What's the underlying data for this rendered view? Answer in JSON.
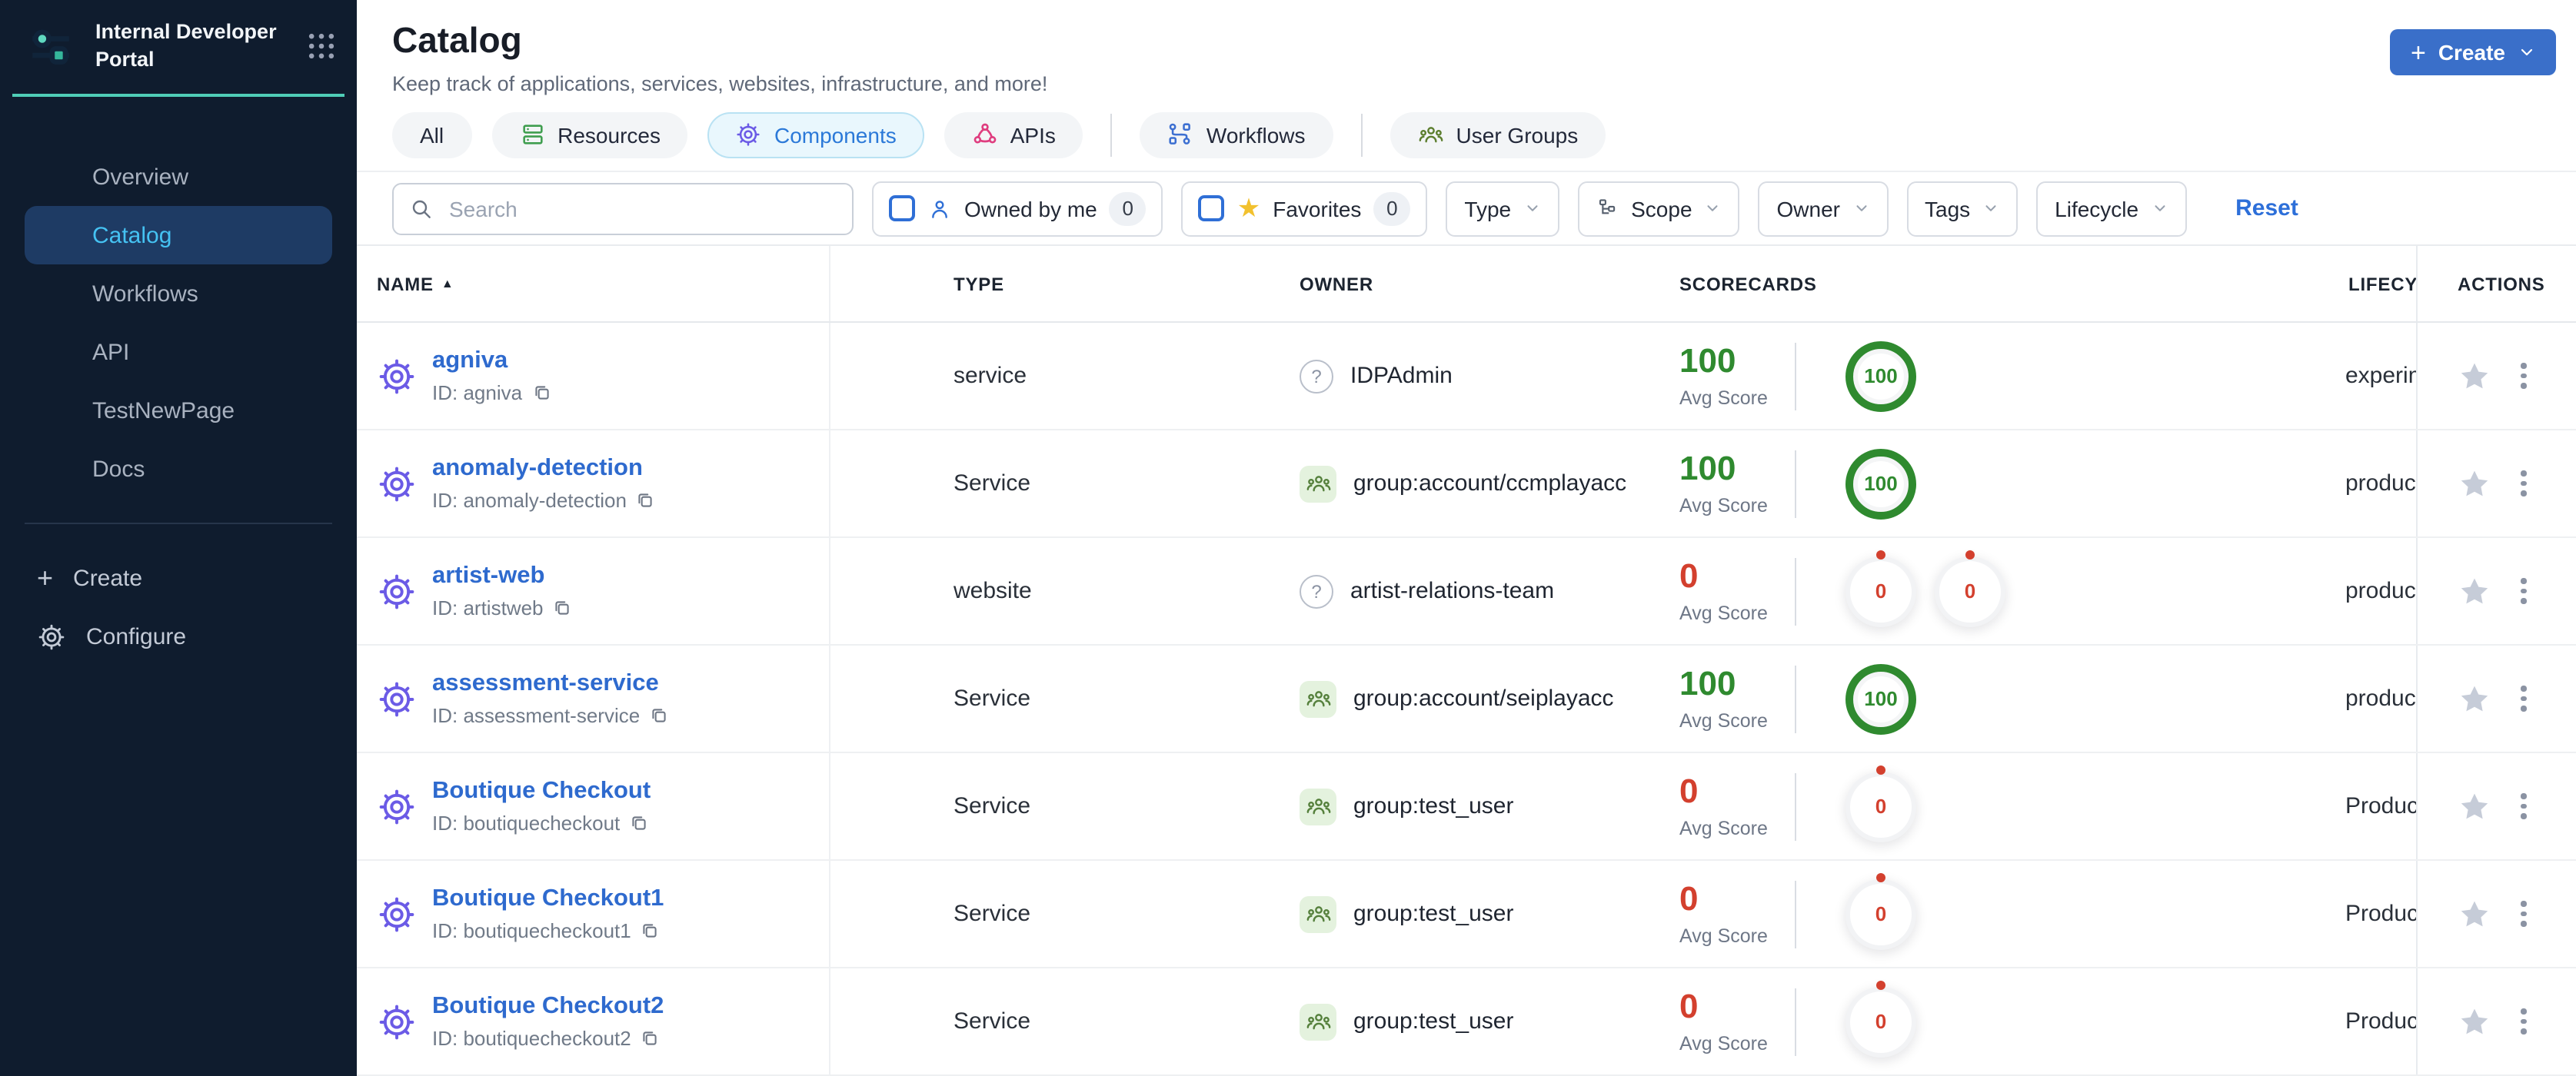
{
  "sidebar": {
    "logo_title": "Internal Developer Portal",
    "nav": [
      {
        "label": "Overview",
        "active": false
      },
      {
        "label": "Catalog",
        "active": true
      },
      {
        "label": "Workflows",
        "active": false
      },
      {
        "label": "API",
        "active": false
      },
      {
        "label": "TestNewPage",
        "active": false
      },
      {
        "label": "Docs",
        "active": false
      }
    ],
    "footer": [
      {
        "label": "Create",
        "icon": "plus-icon"
      },
      {
        "label": "Configure",
        "icon": "gear-icon"
      }
    ]
  },
  "header": {
    "title": "Catalog",
    "subtitle": "Keep track of applications, services, websites, infrastructure, and more!",
    "create_label": "Create"
  },
  "tabs": [
    {
      "label": "All",
      "icon": null,
      "active": false
    },
    {
      "label": "Resources",
      "icon": "resources-icon",
      "active": false
    },
    {
      "label": "Components",
      "icon": "components-gear-icon",
      "active": true
    },
    {
      "label": "APIs",
      "icon": "apis-icon",
      "active": false
    },
    {
      "label": "Workflows",
      "icon": "workflows-icon",
      "active": false
    },
    {
      "label": "User Groups",
      "icon": "user-groups-icon",
      "active": false
    }
  ],
  "filters": {
    "search_placeholder": "Search",
    "toggles": [
      {
        "label": "Owned by me",
        "count": "0",
        "icon": "person-icon"
      },
      {
        "label": "Favorites",
        "count": "0",
        "icon": "star-icon"
      }
    ],
    "dropdowns": [
      {
        "label": "Type",
        "icon": null
      },
      {
        "label": "Scope",
        "icon": "scope-icon"
      },
      {
        "label": "Owner",
        "icon": null
      },
      {
        "label": "Tags",
        "icon": null
      },
      {
        "label": "Lifecycle",
        "icon": null
      }
    ],
    "reset_label": "Reset"
  },
  "table": {
    "columns": {
      "name": "NAME",
      "type": "TYPE",
      "owner": "OWNER",
      "scorecards": "SCORECARDS",
      "lifecycle": "LIFECYCLE",
      "actions": "ACTIONS"
    },
    "avg_score_label": "Avg Score",
    "rows": [
      {
        "name": "agniva",
        "id_label": "ID: agniva",
        "type": "service",
        "owner": {
          "kind": "question",
          "label": "IDPAdmin"
        },
        "score": {
          "value": "100",
          "tone": "green",
          "rings": [
            {
              "value": "100",
              "tone": "green"
            }
          ]
        },
        "lifecycle": "experimental"
      },
      {
        "name": "anomaly-detection",
        "id_label": "ID: anomaly-detection",
        "type": "Service",
        "owner": {
          "kind": "group",
          "label": "group:account/ccmplayacc"
        },
        "score": {
          "value": "100",
          "tone": "green",
          "rings": [
            {
              "value": "100",
              "tone": "green"
            }
          ]
        },
        "lifecycle": "production"
      },
      {
        "name": "artist-web",
        "id_label": "ID: artistweb",
        "type": "website",
        "owner": {
          "kind": "question",
          "label": "artist-relations-team"
        },
        "score": {
          "value": "0",
          "tone": "red",
          "rings": [
            {
              "value": "0",
              "tone": "red"
            },
            {
              "value": "0",
              "tone": "red"
            }
          ]
        },
        "lifecycle": "production"
      },
      {
        "name": "assessment-service",
        "id_label": "ID: assessment-service",
        "type": "Service",
        "owner": {
          "kind": "group",
          "label": "group:account/seiplayacc"
        },
        "score": {
          "value": "100",
          "tone": "green",
          "rings": [
            {
              "value": "100",
              "tone": "green"
            }
          ]
        },
        "lifecycle": "production"
      },
      {
        "name": "Boutique Checkout",
        "id_label": "ID: boutiquecheckout",
        "type": "Service",
        "owner": {
          "kind": "group",
          "label": "group:test_user"
        },
        "score": {
          "value": "0",
          "tone": "red",
          "rings": [
            {
              "value": "0",
              "tone": "red"
            }
          ]
        },
        "lifecycle": "Production"
      },
      {
        "name": "Boutique Checkout1",
        "id_label": "ID: boutiquecheckout1",
        "type": "Service",
        "owner": {
          "kind": "group",
          "label": "group:test_user"
        },
        "score": {
          "value": "0",
          "tone": "red",
          "rings": [
            {
              "value": "0",
              "tone": "red"
            }
          ]
        },
        "lifecycle": "Production"
      },
      {
        "name": "Boutique Checkout2",
        "id_label": "ID: boutiquecheckout2",
        "type": "Service",
        "owner": {
          "kind": "group",
          "label": "group:test_user"
        },
        "score": {
          "value": "0",
          "tone": "red",
          "rings": [
            {
              "value": "0",
              "tone": "red"
            }
          ]
        },
        "lifecycle": "Production"
      }
    ]
  },
  "colors": {
    "sidebar_bg": "#0f1c2e",
    "sidebar_active_bg": "#1e3b64",
    "sidebar_active_text": "#45c2f2",
    "teal_accent": "#4fcdb7",
    "primary_blue": "#3a6fc9",
    "link_blue": "#2e6ace",
    "active_tab_bg": "#e9f7fd",
    "active_tab_border": "#b9e2f3",
    "active_tab_text": "#2b79d8",
    "score_green": "#2f8a2f",
    "score_red": "#d3402e",
    "component_purple": "#6b5be6",
    "resources_green": "#3f9e4f",
    "apis_pink": "#df3d7f",
    "workflows_blue": "#3c6fd1",
    "user_groups_green": "#5c7e2e",
    "group_chip_bg": "#e4f2de",
    "favorite_star_yellow": "#f2c12e"
  }
}
